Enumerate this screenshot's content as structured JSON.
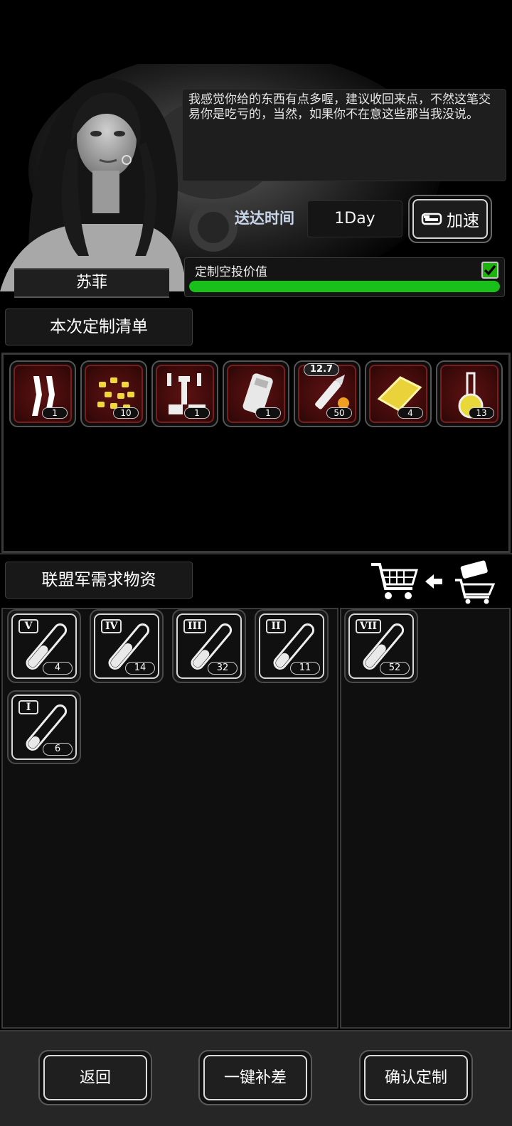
{
  "npc": {
    "name": "苏菲",
    "dialogue": "我感觉你给的东西有点多喔，建议收回来点，不然这笔交易你是吃亏的，当然，如果你不在意这些那当我没说。"
  },
  "delivery": {
    "label": "送达时间",
    "value": "1Day",
    "speed_button_label": "加速"
  },
  "airdrop_value": {
    "label": "定制空投价值",
    "progress": 1.0,
    "checked": true
  },
  "order_list": {
    "title": "本次定制清单",
    "items": [
      {
        "icon": "ampoule-pair-icon",
        "count": "1"
      },
      {
        "icon": "gold-nuggets-icon",
        "count": "10"
      },
      {
        "icon": "crafting-parts-icon",
        "count": "1"
      },
      {
        "icon": "armor-plate-icon",
        "count": "1"
      },
      {
        "icon": "bullet-icon",
        "count": "50",
        "tag": "12.7"
      },
      {
        "icon": "gold-bar-icon",
        "count": "4"
      },
      {
        "icon": "flask-icon",
        "count": "13"
      }
    ]
  },
  "demand": {
    "title": "联盟军需求物资",
    "left_items": [
      {
        "tier": "V",
        "count": "4",
        "fill": 0.45
      },
      {
        "tier": "IV",
        "count": "14",
        "fill": 0.55
      },
      {
        "tier": "III",
        "count": "32",
        "fill": 0.35
      },
      {
        "tier": "II",
        "count": "11",
        "fill": 0.25
      },
      {
        "tier": "I",
        "count": "6",
        "fill": 0.2
      }
    ],
    "right_items": [
      {
        "tier": "VII",
        "count": "52",
        "fill": 0.5
      }
    ]
  },
  "buttons": {
    "back": "返回",
    "fill_gap": "一键补差",
    "confirm": "确认定制"
  },
  "colors": {
    "progress_green": "#19c01a",
    "item_red": "#5d1212"
  }
}
